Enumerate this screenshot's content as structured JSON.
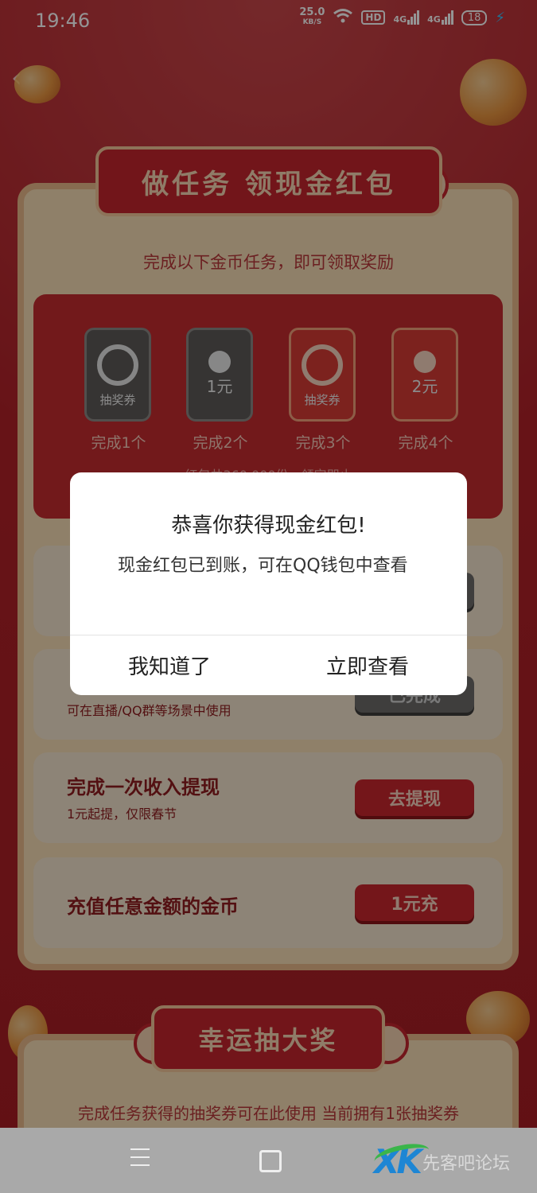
{
  "status_bar": {
    "time": "19:46",
    "speed_value": "25.0",
    "speed_unit": "KB/S",
    "hd_badge": "HD",
    "network_1": "4G",
    "network_2": "4G",
    "battery": "18"
  },
  "header": {
    "banner_title": "做任务 领现金红包",
    "subtitle": "完成以下金币任务，即可领取奖励"
  },
  "rewards": [
    {
      "badge": "抽奖券",
      "caption": "完成1个",
      "style": "gray"
    },
    {
      "badge": "1元",
      "caption": "完成2个",
      "style": "gray"
    },
    {
      "badge": "抽奖券",
      "caption": "完成3个",
      "style": "red"
    },
    {
      "badge": "2元",
      "caption": "完成4个",
      "style": "red"
    }
  ],
  "strip_note": "红包共360,000份，领完即止",
  "tasks": [
    {
      "title": "",
      "subtitle": "",
      "button": ""
    },
    {
      "title": "",
      "subtitle": "可在直播/QQ群等场景中使用",
      "button": "已完成"
    },
    {
      "title": "完成一次收入提现",
      "subtitle": "1元起提，仅限春节",
      "button": "去提现"
    },
    {
      "title": "充值任意金额的金币",
      "subtitle": "",
      "button": "1元充"
    }
  ],
  "lucky": {
    "banner_title": "幸运抽大奖",
    "description": "完成任务获得的抽奖券可在此使用 当前拥有1张抽奖券"
  },
  "dialog": {
    "title": "恭喜你获得现金红包!",
    "message": "现金红包已到账，可在QQ钱包中查看",
    "left_button": "我知道了",
    "right_button": "立即查看"
  },
  "watermark": {
    "logo": "XK",
    "text": "先客吧论坛"
  },
  "colors": {
    "page_red": "#b22229",
    "card_beige": "#f6dcb6",
    "button_red": "#c8262e",
    "dialog_bg": "#ffffff"
  }
}
